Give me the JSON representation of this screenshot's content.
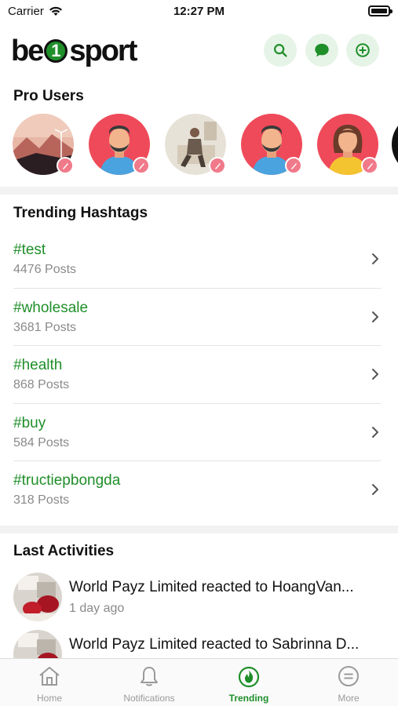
{
  "status_bar": {
    "carrier": "Carrier",
    "time": "12:27 PM"
  },
  "header": {
    "logo_text_left": "be",
    "logo_text_mid": "1",
    "logo_text_right": "sport",
    "icons": [
      "search-icon",
      "chat-icon",
      "add-circle-icon"
    ]
  },
  "pro_users": {
    "title": "Pro Users",
    "users": [
      {
        "avatar": "landscape-photo"
      },
      {
        "avatar": "male-illustration"
      },
      {
        "avatar": "person-photo"
      },
      {
        "avatar": "male-illustration"
      },
      {
        "avatar": "female-illustration"
      }
    ]
  },
  "trending": {
    "title": "Trending Hashtags",
    "items": [
      {
        "tag": "#test",
        "count": "4476 Posts"
      },
      {
        "tag": "#wholesale",
        "count": "3681 Posts"
      },
      {
        "tag": "#health",
        "count": "868 Posts"
      },
      {
        "tag": "#buy",
        "count": "584 Posts"
      },
      {
        "tag": "#tructiepbongda",
        "count": "318 Posts"
      }
    ]
  },
  "activities": {
    "title": "Last Activities",
    "items": [
      {
        "text": "World Payz Limited reacted to HoangVan...",
        "ago": "1 day ago"
      },
      {
        "text": "World Payz Limited reacted to Sabrinna D...",
        "ago": ""
      }
    ]
  },
  "tabs": [
    {
      "label": "Home",
      "icon": "home-icon",
      "active": false
    },
    {
      "label": "Notifications",
      "icon": "bell-icon",
      "active": false
    },
    {
      "label": "Trending",
      "icon": "flame-icon",
      "active": true
    },
    {
      "label": "More",
      "icon": "more-icon",
      "active": false
    }
  ],
  "colors": {
    "accent": "#1f8f2a",
    "accent_bg": "#e6f4e7",
    "muted": "#8a8a8a",
    "badge": "#f07a8a"
  }
}
